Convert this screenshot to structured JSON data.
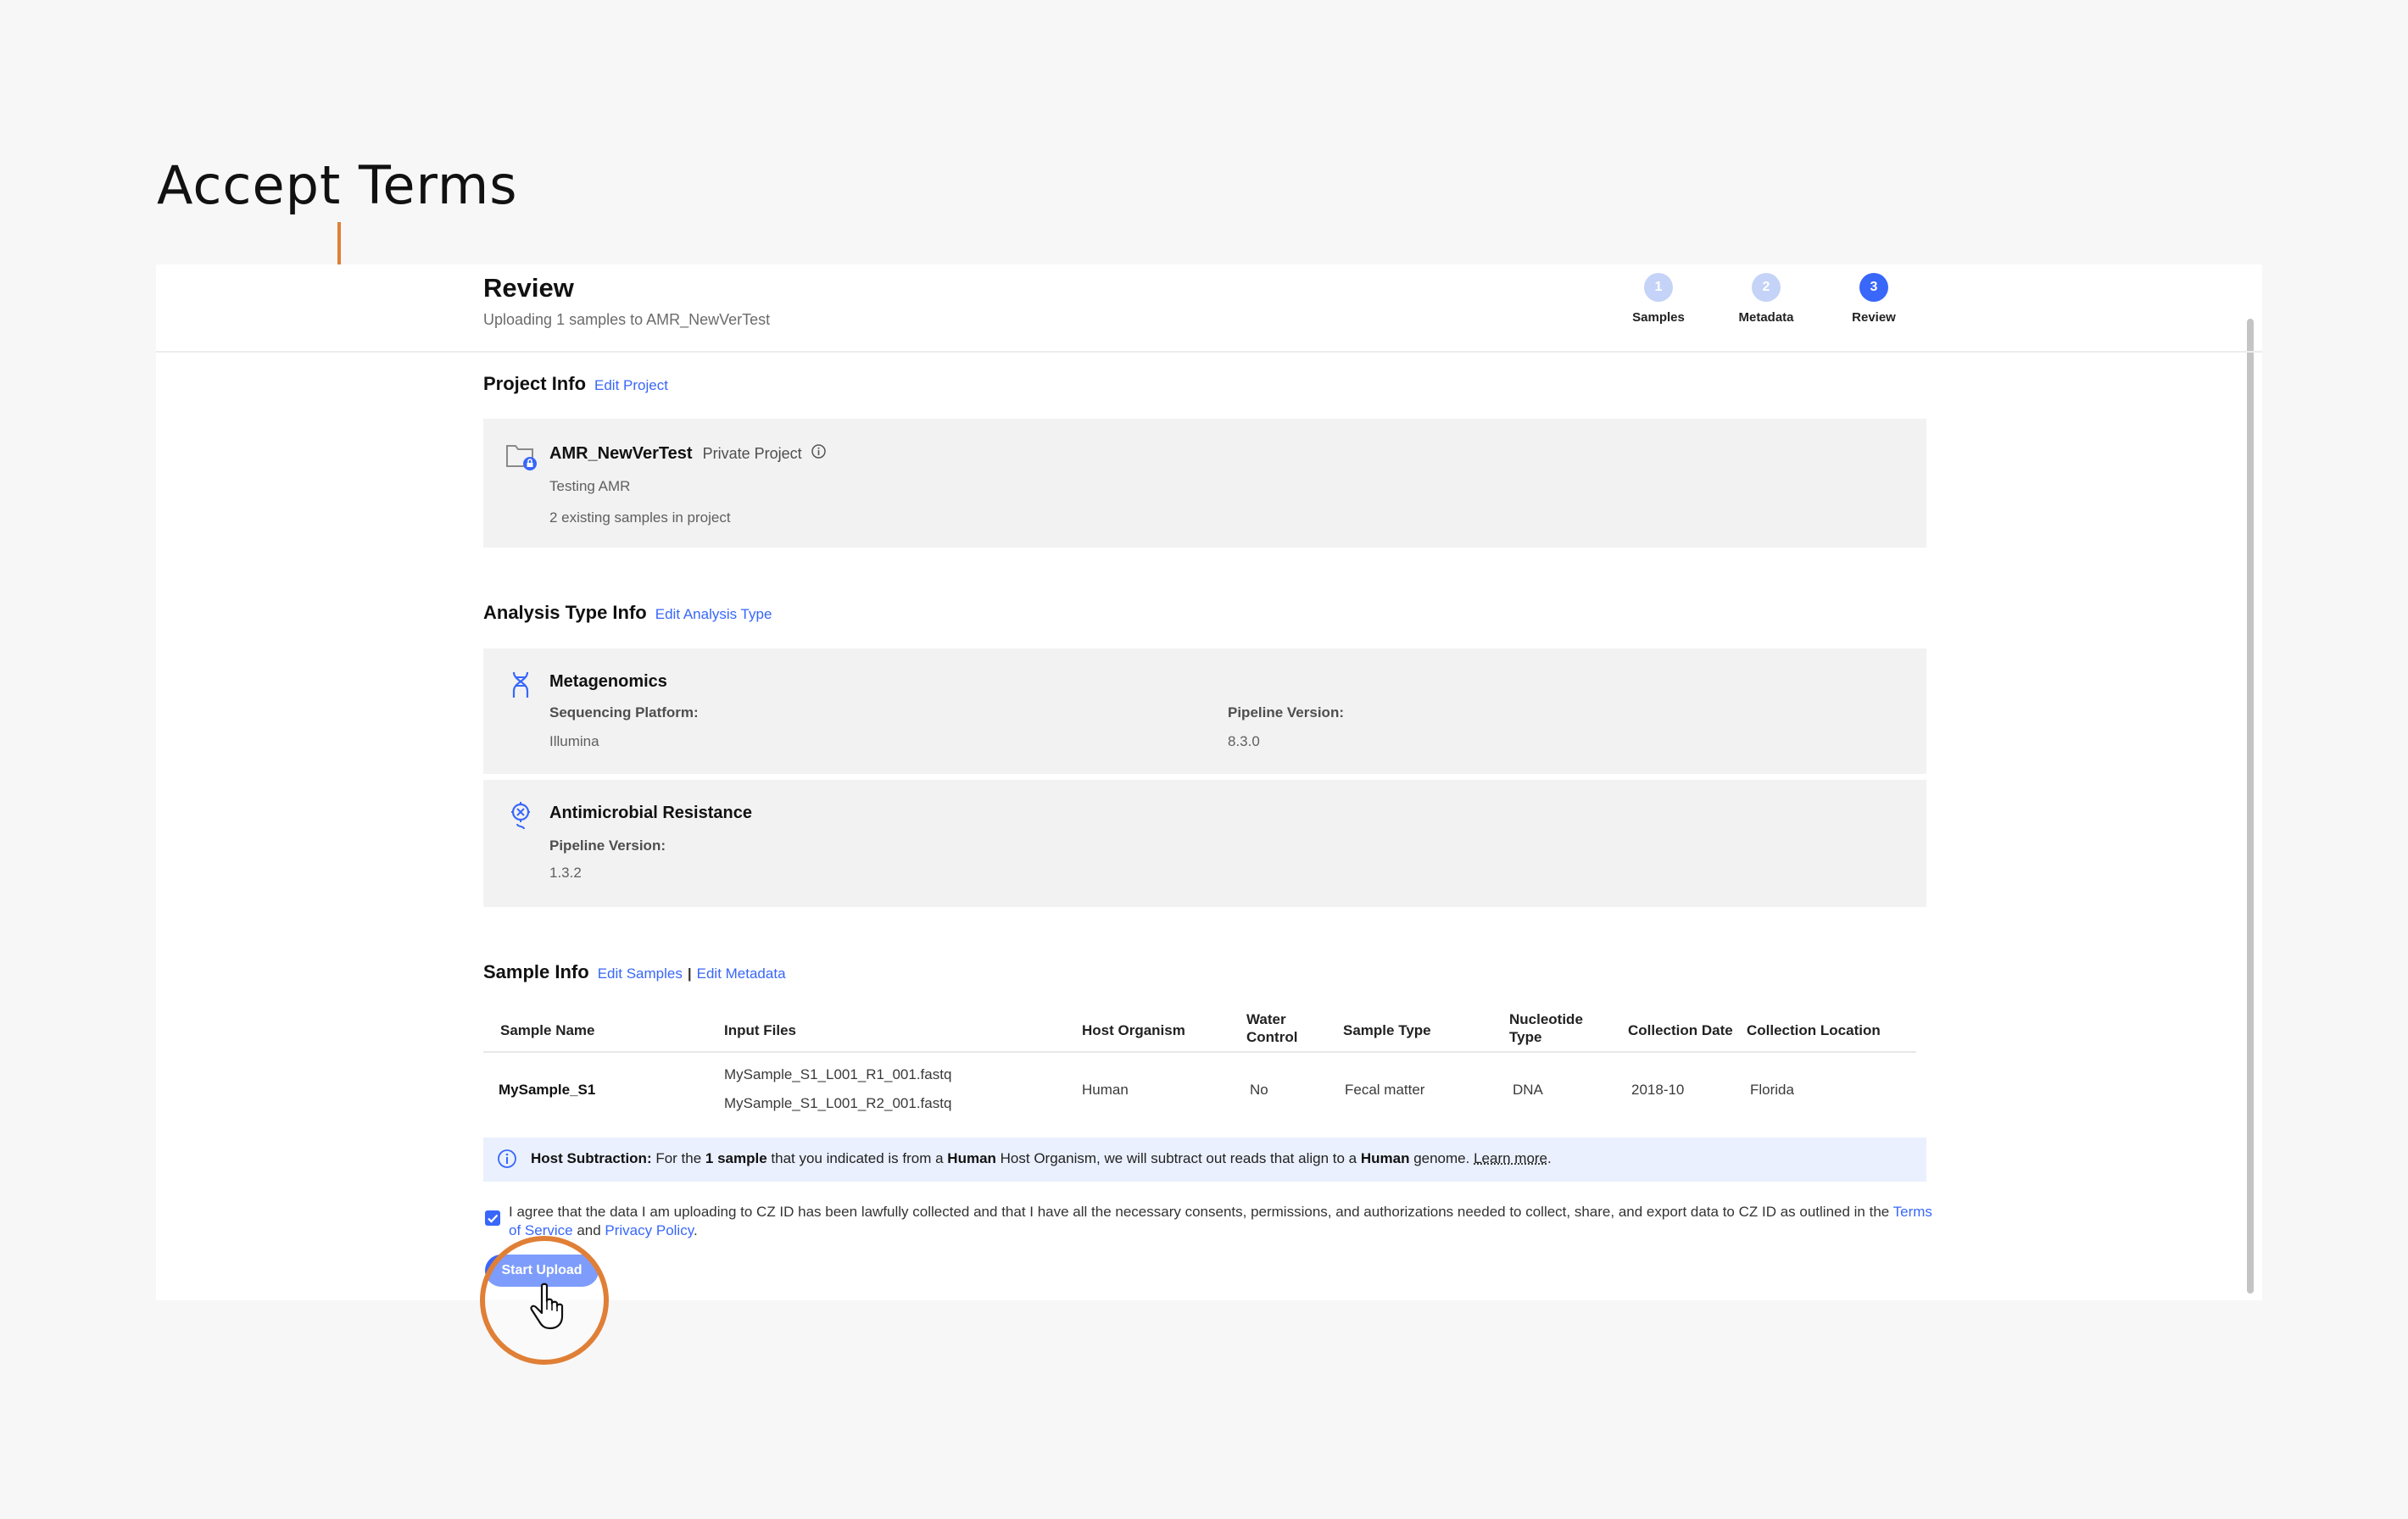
{
  "annotation": {
    "title": "Accept Terms"
  },
  "header": {
    "title": "Review",
    "subtitle": "Uploading 1 samples to AMR_NewVerTest",
    "steps": [
      {
        "num": "1",
        "label": "Samples"
      },
      {
        "num": "2",
        "label": "Metadata"
      },
      {
        "num": "3",
        "label": "Review"
      }
    ]
  },
  "project_info": {
    "heading": "Project Info",
    "edit_link": "Edit Project",
    "name": "AMR_NewVerTest",
    "visibility": "Private Project",
    "description": "Testing AMR",
    "existing": "2 existing samples in project"
  },
  "analysis_info": {
    "heading": "Analysis Type Info",
    "edit_link": "Edit Analysis Type",
    "metagenomics": {
      "title": "Metagenomics",
      "platform_label": "Sequencing Platform:",
      "platform_value": "Illumina",
      "pipeline_label": "Pipeline Version:",
      "pipeline_value": "8.3.0"
    },
    "amr": {
      "title": "Antimicrobial Resistance",
      "pipeline_label": "Pipeline Version:",
      "pipeline_value": "1.3.2"
    }
  },
  "sample_info": {
    "heading": "Sample Info",
    "edit_samples": "Edit Samples",
    "separator": "|",
    "edit_metadata": "Edit Metadata",
    "columns": {
      "sample_name": "Sample Name",
      "input_files": "Input Files",
      "host_organism": "Host Organism",
      "water_control_1": "Water",
      "water_control_2": "Control",
      "sample_type": "Sample Type",
      "nucleotide_1": "Nucleotide",
      "nucleotide_2": "Type",
      "collection_date": "Collection Date",
      "collection_location": "Collection Location"
    },
    "row": {
      "sample_name": "MySample_S1",
      "file1": "MySample_S1_L001_R1_001.fastq",
      "file2": "MySample_S1_L001_R2_001.fastq",
      "host_organism": "Human",
      "water_control": "No",
      "sample_type": "Fecal matter",
      "nucleotide_type": "DNA",
      "collection_date": "2018-10",
      "collection_location": "Florida"
    }
  },
  "banner": {
    "lead": "Host Subtraction:",
    "t1": " For the ",
    "b1": "1 sample",
    "t2": " that you indicated is from a ",
    "b2": "Human",
    "t3": " Host Organism, we will subtract out reads that align to a ",
    "b3": "Human",
    "t4": " genome. ",
    "learn_more": "Learn more",
    "t5": "."
  },
  "terms": {
    "text": "I agree that the data I am uploading to CZ ID has been lawfully collected and that I have all the necessary consents, permissions, and authorizations needed to collect, share, and export data to CZ ID as outlined in the ",
    "tos": "Terms of Service",
    "and": " and ",
    "privacy": "Privacy Policy",
    "end": "."
  },
  "start_button": "Start Upload",
  "colors": {
    "accent": "#3867fa",
    "annotation": "#e07f36"
  },
  "icons": [
    "folder-lock-icon",
    "info-icon",
    "dna-icon",
    "amr-gene-icon",
    "checkbox-checked-icon",
    "hand-pointer-icon"
  ]
}
